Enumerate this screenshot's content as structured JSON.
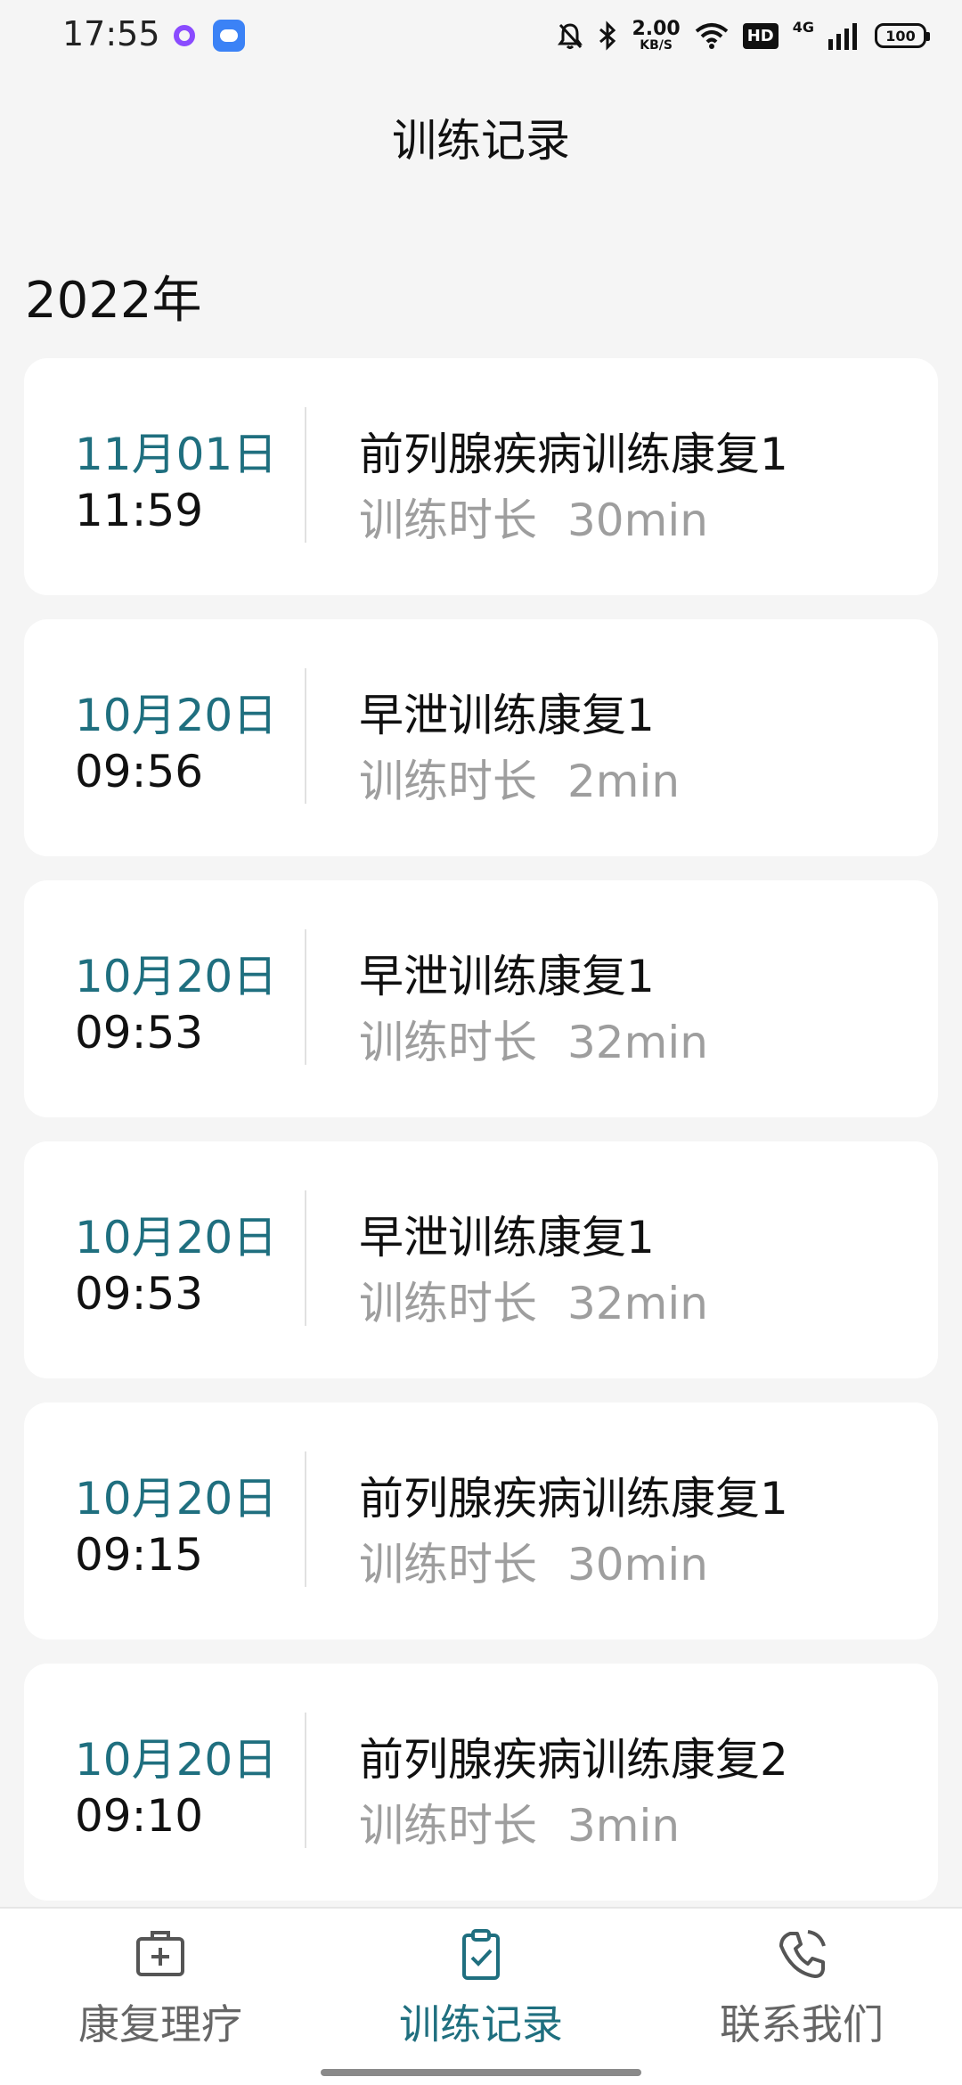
{
  "status_bar": {
    "time": "17:55",
    "net_speed_value": "2.00",
    "net_speed_unit": "KB/S",
    "hd_label": "HD",
    "network_label": "4G",
    "battery_level": "100",
    "icons": [
      "ring-app-icon",
      "cloud-app-icon",
      "bell-muted-icon",
      "bluetooth-icon",
      "wifi-icon",
      "signal-icon",
      "battery-icon"
    ]
  },
  "header": {
    "title": "训练记录"
  },
  "year": "2022年",
  "records": [
    {
      "date": "11月01日",
      "time": "11:59",
      "title": "前列腺疾病训练康复1",
      "duration_label": "训练时长",
      "duration": "30min"
    },
    {
      "date": "10月20日",
      "time": "09:56",
      "title": "早泄训练康复1",
      "duration_label": "训练时长",
      "duration": "2min"
    },
    {
      "date": "10月20日",
      "time": "09:53",
      "title": "早泄训练康复1",
      "duration_label": "训练时长",
      "duration": "32min"
    },
    {
      "date": "10月20日",
      "time": "09:53",
      "title": "早泄训练康复1",
      "duration_label": "训练时长",
      "duration": "32min"
    },
    {
      "date": "10月20日",
      "time": "09:15",
      "title": "前列腺疾病训练康复1",
      "duration_label": "训练时长",
      "duration": "30min"
    },
    {
      "date": "10月20日",
      "time": "09:10",
      "title": "前列腺疾病训练康复2",
      "duration_label": "训练时长",
      "duration": "3min"
    }
  ],
  "bottom_nav": {
    "items": [
      {
        "label": "康复理疗",
        "icon": "medical-kit-icon",
        "active": false
      },
      {
        "label": "训练记录",
        "icon": "clipboard-check-icon",
        "active": true
      },
      {
        "label": "联系我们",
        "icon": "phone-icon",
        "active": false
      }
    ]
  },
  "colors": {
    "accent": "#1f6f7f",
    "background": "#f5f5f5",
    "card": "#ffffff",
    "muted_text": "#9e9e9e"
  }
}
